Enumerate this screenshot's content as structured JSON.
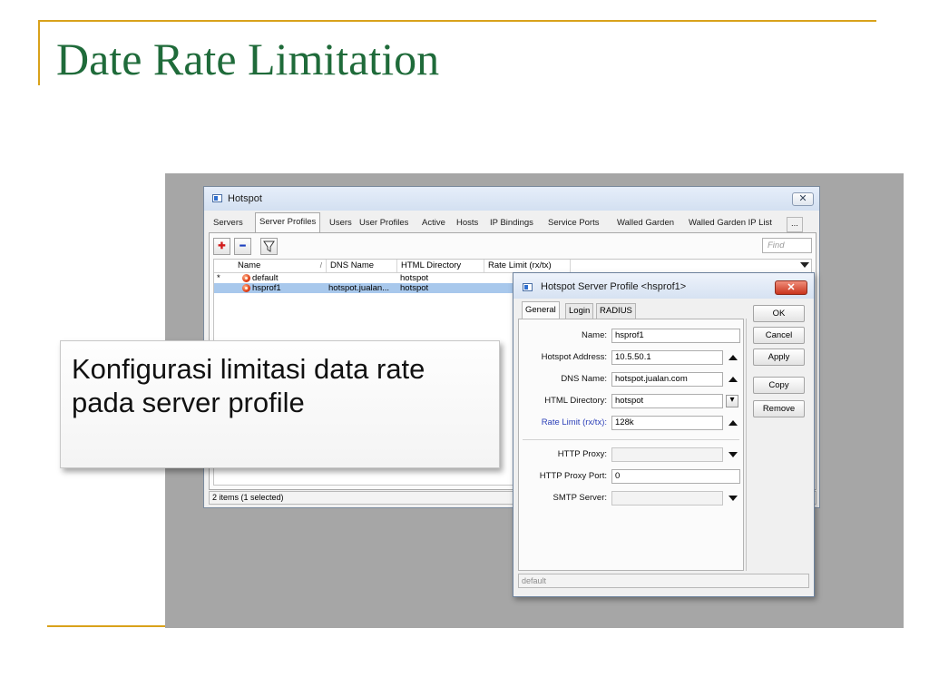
{
  "slide": {
    "title": "Date Rate Limitation",
    "callout": "Konfigurasi limitasi data rate pada server profile"
  },
  "colors": {
    "title": "#1f6b3a",
    "rule": "#d9a21b",
    "selection": "#a8c8ec",
    "panel_bg": "#a6a6a6"
  },
  "hotspot_window": {
    "title": "Hotspot",
    "close_glyph": "✕",
    "tabs": [
      {
        "label": "Servers"
      },
      {
        "label": "Server Profiles",
        "active": true
      },
      {
        "label": "Users"
      },
      {
        "label": "User Profiles"
      },
      {
        "label": "Active"
      },
      {
        "label": "Hosts"
      },
      {
        "label": "IP Bindings"
      },
      {
        "label": "Service Ports"
      },
      {
        "label": "Walled Garden"
      },
      {
        "label": "Walled Garden IP List"
      },
      {
        "label": "..."
      }
    ],
    "toolbar": {
      "add_glyph": "✚",
      "remove_glyph": "━",
      "filter_icon": "filter-icon",
      "find_placeholder": "Find"
    },
    "columns": [
      "Name",
      "DNS Name",
      "HTML Directory",
      "Rate Limit (rx/tx)"
    ],
    "rows": [
      {
        "flag": "*",
        "name": "default",
        "dns_name": "",
        "html_directory": "hotspot",
        "rate_limit": "",
        "selected": false
      },
      {
        "flag": "",
        "name": "hsprof1",
        "dns_name": "hotspot.jualan...",
        "html_directory": "hotspot",
        "rate_limit": "",
        "selected": true
      }
    ],
    "status": "2 items (1 selected)"
  },
  "profile_dialog": {
    "title": "Hotspot Server Profile <hsprof1>",
    "close_glyph": "✕",
    "tabs": [
      {
        "label": "General",
        "active": true
      },
      {
        "label": "Login"
      },
      {
        "label": "RADIUS"
      }
    ],
    "fields": {
      "name": {
        "label": "Name:",
        "value": "hsprof1"
      },
      "hotspot_address": {
        "label": "Hotspot Address:",
        "value": "10.5.50.1"
      },
      "dns_name": {
        "label": "DNS Name:",
        "value": "hotspot.jualan.com"
      },
      "html_directory": {
        "label": "HTML Directory:",
        "value": "hotspot"
      },
      "rate_limit": {
        "label": "Rate Limit (rx/tx):",
        "value": "128k"
      },
      "http_proxy": {
        "label": "HTTP Proxy:",
        "value": ""
      },
      "http_proxy_port": {
        "label": "HTTP Proxy Port:",
        "value": "0"
      },
      "smtp_server": {
        "label": "SMTP Server:",
        "value": ""
      }
    },
    "buttons": {
      "ok": "OK",
      "cancel": "Cancel",
      "apply": "Apply",
      "copy": "Copy",
      "remove": "Remove"
    },
    "status": "default"
  }
}
